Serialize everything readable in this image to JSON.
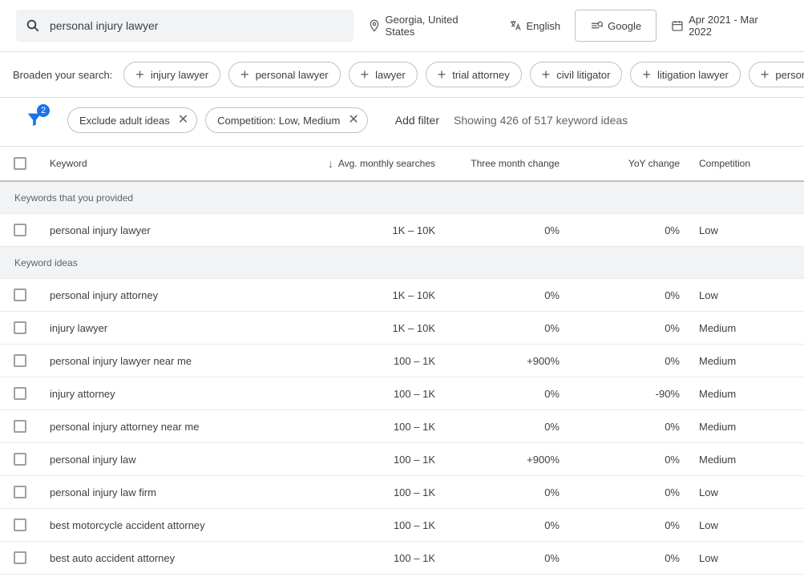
{
  "search": {
    "value": "personal injury lawyer"
  },
  "location": "Georgia, United States",
  "language": "English",
  "network": "Google",
  "date_range": "Apr 2021 - Mar 2022",
  "broaden": {
    "label": "Broaden your search:",
    "items": [
      "injury lawyer",
      "personal lawyer",
      "lawyer",
      "trial attorney",
      "civil litigator",
      "litigation lawyer",
      "personal injury"
    ]
  },
  "filters": {
    "badge": "2",
    "chips": [
      "Exclude adult ideas",
      "Competition: Low, Medium"
    ],
    "add_label": "Add filter",
    "result_text": "Showing 426 of 517 keyword ideas"
  },
  "columns": {
    "keyword": "Keyword",
    "searches": "Avg. monthly searches",
    "three_month": "Three month change",
    "yoy": "YoY change",
    "competition": "Competition"
  },
  "sections": {
    "provided": "Keywords that you provided",
    "ideas": "Keyword ideas"
  },
  "rows_provided": [
    {
      "keyword": "personal injury lawyer",
      "searches": "1K – 10K",
      "three_month": "0%",
      "yoy": "0%",
      "competition": "Low"
    }
  ],
  "rows_ideas": [
    {
      "keyword": "personal injury attorney",
      "searches": "1K – 10K",
      "three_month": "0%",
      "yoy": "0%",
      "competition": "Low"
    },
    {
      "keyword": "injury lawyer",
      "searches": "1K – 10K",
      "three_month": "0%",
      "yoy": "0%",
      "competition": "Medium"
    },
    {
      "keyword": "personal injury lawyer near me",
      "searches": "100 – 1K",
      "three_month": "+900%",
      "yoy": "0%",
      "competition": "Medium"
    },
    {
      "keyword": "injury attorney",
      "searches": "100 – 1K",
      "three_month": "0%",
      "yoy": "-90%",
      "competition": "Medium"
    },
    {
      "keyword": "personal injury attorney near me",
      "searches": "100 – 1K",
      "three_month": "0%",
      "yoy": "0%",
      "competition": "Medium"
    },
    {
      "keyword": "personal injury law",
      "searches": "100 – 1K",
      "three_month": "+900%",
      "yoy": "0%",
      "competition": "Medium"
    },
    {
      "keyword": "personal injury law firm",
      "searches": "100 – 1K",
      "three_month": "0%",
      "yoy": "0%",
      "competition": "Low"
    },
    {
      "keyword": "best motorcycle accident attorney",
      "searches": "100 – 1K",
      "three_month": "0%",
      "yoy": "0%",
      "competition": "Low"
    },
    {
      "keyword": "best auto accident attorney",
      "searches": "100 – 1K",
      "three_month": "0%",
      "yoy": "0%",
      "competition": "Low"
    }
  ]
}
